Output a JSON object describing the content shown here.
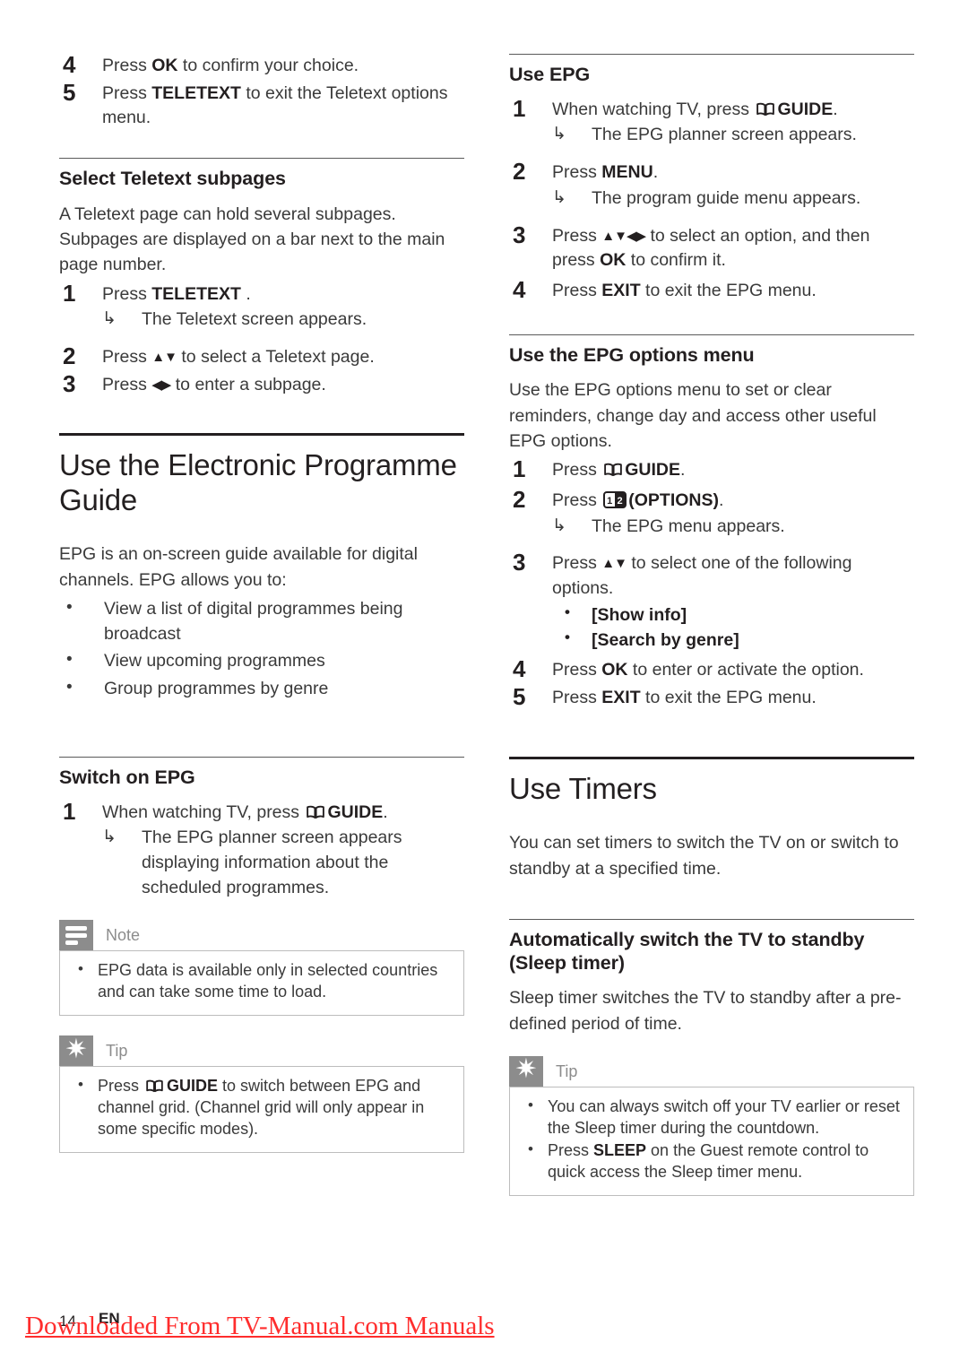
{
  "document": {
    "page_number": "14",
    "language_code": "EN",
    "watermark": "Downloaded From TV-Manual.com Manuals"
  },
  "icons": {
    "guide": "book-icon",
    "options": "options-12-icon",
    "note": "note-lines-icon",
    "tip": "asterisk-star-icon",
    "result_arrow": "↳",
    "nav_up_down": "▲▼",
    "nav_left_right": "◀▶",
    "nav_all": "▲▼◀▶"
  },
  "left_column": {
    "continued_steps": [
      {
        "num": "4",
        "pre": "Press ",
        "key": "OK",
        "post": " to confirm your choice."
      },
      {
        "num": "5",
        "pre": "Press ",
        "key": "TELETEXT",
        "post": " to exit the Teletext options menu."
      }
    ],
    "teletext_subpages": {
      "heading": "Select Teletext subpages",
      "intro": "A Teletext page can hold several subpages. Subpages are displayed on a bar next to the main page number.",
      "steps": [
        {
          "num": "1",
          "pre": "Press ",
          "key": "TELETEXT",
          "post": " .",
          "result": "The Teletext screen appears."
        },
        {
          "num": "2",
          "pre": "Press ",
          "keys": "▲▼",
          "post": " to select a Teletext page."
        },
        {
          "num": "3",
          "pre": "Press ",
          "keys": "◀▶",
          "post": " to enter a subpage."
        }
      ]
    },
    "epg_section": {
      "title": "Use the Electronic Programme Guide",
      "intro": "EPG is an on-screen guide available for digital channels. EPG allows you to:",
      "bullets": [
        "View a list of digital programmes being broadcast",
        "View upcoming programmes",
        "Group programmes by genre"
      ]
    },
    "switch_on_epg": {
      "heading": "Switch on EPG",
      "steps": [
        {
          "num": "1",
          "pre": "When watching TV, press ",
          "key": "GUIDE",
          "post": ".",
          "result": "The EPG planner screen appears displaying information about the scheduled programmes."
        }
      ]
    },
    "note_box": {
      "label": "Note",
      "items": [
        "EPG data is available only in selected countries and can take some time to load."
      ]
    },
    "tip_box": {
      "label": "Tip",
      "items": [
        {
          "pre": "Press ",
          "key": "GUIDE",
          "post": " to switch between EPG and channel grid. (Channel grid will only appear in some specific modes)."
        }
      ]
    }
  },
  "right_column": {
    "use_epg": {
      "heading": "Use EPG",
      "steps": [
        {
          "num": "1",
          "pre": "When watching TV, press ",
          "key": "GUIDE",
          "post": ".",
          "result": "The EPG planner screen appears."
        },
        {
          "num": "2",
          "pre": " Press ",
          "key": "MENU",
          "post": ".",
          "result": "The program guide menu appears."
        },
        {
          "num": "3",
          "pre": "Press ",
          "keys": "▲▼◀▶",
          "post": " to select an option, and then press ",
          "key2": "OK",
          "post2": " to confirm it."
        },
        {
          "num": "4",
          "pre": "Press ",
          "key": "EXIT",
          "post": " to exit the EPG menu."
        }
      ]
    },
    "epg_options_menu": {
      "heading": "Use the EPG options menu",
      "intro": "Use the EPG options menu to set or clear reminders, change day and access other useful EPG options.",
      "steps": [
        {
          "num": "1",
          "pre": "Press ",
          "key": "GUIDE",
          "post": "."
        },
        {
          "num": "2",
          "pre": "Press ",
          "key": "(OPTIONS)",
          "post": ".",
          "result": "The EPG menu appears."
        },
        {
          "num": "3",
          "pre": "Press ",
          "keys": "▲▼",
          "post": " to select one of the following options."
        },
        {
          "num": "4",
          "pre": "Press ",
          "key": "OK",
          "post": " to enter or activate the option."
        },
        {
          "num": "5",
          "pre": "Press ",
          "key": "EXIT",
          "post": " to exit the EPG menu."
        }
      ],
      "option_items": [
        "[Show info]",
        "[Search by genre]"
      ]
    },
    "timers_section": {
      "title": "Use Timers",
      "intro": "You can set timers to switch the TV on or switch to standby at a specified time."
    },
    "sleep_timer": {
      "heading": "Automatically switch the TV to standby (Sleep timer)",
      "intro": "Sleep timer switches the TV to standby after a pre-defined period of time."
    },
    "tip_box": {
      "label": "Tip",
      "items": [
        {
          "pre": "You can always switch off your TV earlier or reset the Sleep timer during the countdown.",
          "key": "",
          "post": ""
        },
        {
          "pre": "Press ",
          "key": "SLEEP",
          "post": " on the Guest remote control to quick access the Sleep timer menu."
        }
      ]
    }
  }
}
